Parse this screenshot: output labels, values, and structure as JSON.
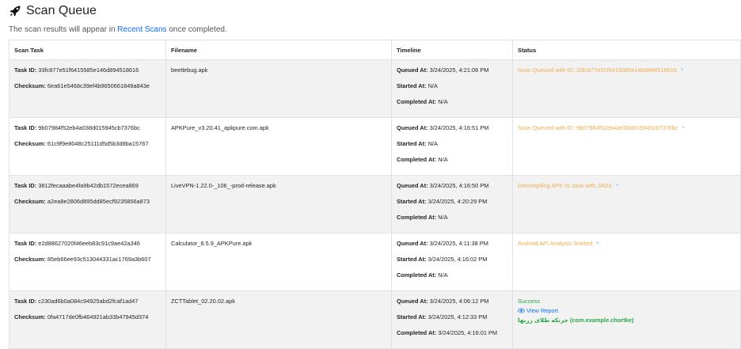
{
  "header": {
    "title": "Scan Queue",
    "subtitle_prefix": "The scan results will appear in ",
    "subtitle_link": "Recent Scans",
    "subtitle_suffix": " once completed."
  },
  "table": {
    "columns": [
      "Scan Task",
      "Filename",
      "Timeline",
      "Status"
    ],
    "labels": {
      "task_id": "Task ID:",
      "checksum": "Checksum:",
      "queued": "Queued At:",
      "started": "Started At:",
      "completed": "Completed At:"
    },
    "rows": [
      {
        "task_id": "33fc877e51f6415585e146d894518616",
        "checksum": "6ea61e5468c39ef4b9650661849a843e",
        "filename": "beetlebug.apk",
        "queued": "3/24/2025, 4:21:06 PM",
        "started": "N/A",
        "completed": "N/A",
        "status": "Scan Queued with ID: 33fc877e51f6415585e146d894518616"
      },
      {
        "task_id": "9b07984f52eb4a038d015945cb7376bc",
        "checksum": "61c9f9e8048c25111d5d5b3d8ba15767",
        "filename": "APKPure_v3.20.41_apkpure.com.apk",
        "queued": "3/24/2025, 4:16:51 PM",
        "started": "N/A",
        "completed": "N/A",
        "status": "Scan Queued with ID: 9b07984f52eb4a038d015945cb7376bc"
      },
      {
        "task_id": "3812fecaaabe4fa9b42db1572ecea869",
        "checksum": "a2ea8e2806d895dd85ecf9235856a873",
        "filename": "LiveVPN-1.22.0-_106_-prod-release.apk",
        "queued": "3/24/2025, 4:16:50 PM",
        "started": "3/24/2025, 4:20:29 PM",
        "completed": "N/A",
        "status": "Decompiling APK to Java with JADX"
      },
      {
        "task_id": "e2d88627020f46eeb83c91c9ae42a346",
        "checksum": "85eb66ee93c513044331ac1769a3b607",
        "filename": "Calculator_8.5.9_APKPure.apk",
        "queued": "3/24/2025, 4:11:38 PM",
        "started": "3/24/2025, 4:16:02 PM",
        "completed": "N/A",
        "status": "Android API Analysis Started"
      },
      {
        "task_id": "c230ad6b0a084c94925abd2fcaf1ad47",
        "checksum": "0fa4717de0fb464921ab33b47945d374",
        "filename": "ZCTTablet_02.20.02.apk",
        "queued": "3/24/2025, 4:06:12 PM",
        "started": "3/24/2025, 4:12:33 PM",
        "completed": "3/24/2025, 4:16:01 PM",
        "status": "Success",
        "view_report": "View Report",
        "app_name": "جرنکه طلای زربها (com.example.chortke)"
      }
    ]
  },
  "colors": {
    "pending": "#f0ad4e",
    "success": "#28a745",
    "link": "#0d6efd",
    "stripe": "#f2f2f2"
  },
  "icons": {
    "title": "rocket-icon",
    "pending": "spinner-icon",
    "report": "eye-icon"
  }
}
